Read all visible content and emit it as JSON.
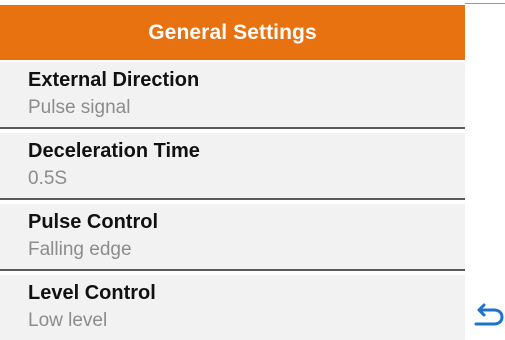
{
  "header": {
    "title": "General Settings"
  },
  "settings": [
    {
      "label": "External Direction",
      "value": "Pulse signal"
    },
    {
      "label": "Deceleration Time",
      "value": "0.5S"
    },
    {
      "label": "Pulse Control",
      "value": "Falling edge"
    },
    {
      "label": "Level Control",
      "value": "Low level"
    }
  ],
  "icons": {
    "back": "back-arrow-icon"
  },
  "colors": {
    "header_bg": "#e8720f",
    "header_text": "#ffffff",
    "item_bg": "#f2f2f2",
    "divider": "#5a5a5a",
    "label_text": "#111111",
    "value_text": "#8c8c8c",
    "icon_blue": "#1e73c9"
  }
}
